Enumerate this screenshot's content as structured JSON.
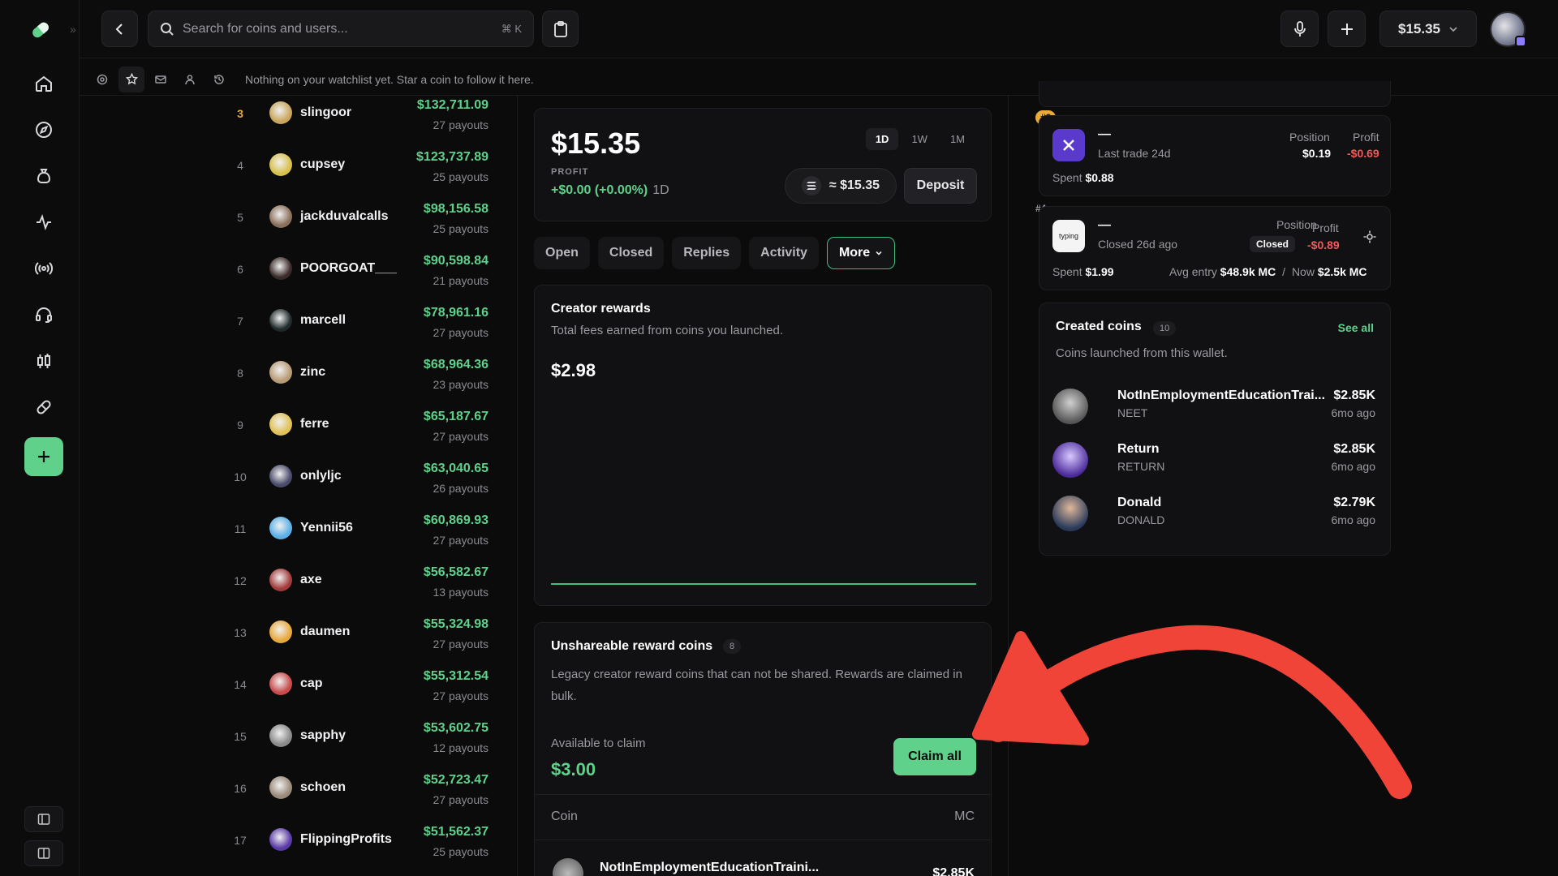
{
  "header": {
    "search_placeholder": "Search for coins and users...",
    "search_shortcut": "⌘  K",
    "balance": "$15.35"
  },
  "watchlist": {
    "message": "Nothing on your watchlist yet. Star a coin to follow it here."
  },
  "leaderboard": [
    {
      "rank": "3",
      "name": "slingoor",
      "amount": "$132,711.09",
      "payouts": "27 payouts",
      "color": "#c9a55a"
    },
    {
      "rank": "4",
      "name": "cupsey",
      "amount": "$123,737.89",
      "payouts": "25 payouts",
      "color": "#d8c04a"
    },
    {
      "rank": "5",
      "name": "jackduvalcalls",
      "amount": "$98,156.58",
      "payouts": "25 payouts",
      "color": "#8a6f5a"
    },
    {
      "rank": "6",
      "name": "POORGOAT___",
      "amount": "$90,598.84",
      "payouts": "21 payouts",
      "color": "#3a2a2a"
    },
    {
      "rank": "7",
      "name": "marcell",
      "amount": "$78,961.16",
      "payouts": "27 payouts",
      "color": "#1f2a2a"
    },
    {
      "rank": "8",
      "name": "zinc",
      "amount": "$68,964.36",
      "payouts": "23 payouts",
      "color": "#b89a74"
    },
    {
      "rank": "9",
      "name": "ferre",
      "amount": "$65,187.67",
      "payouts": "27 payouts",
      "color": "#e1c054"
    },
    {
      "rank": "10",
      "name": "onlyljc",
      "amount": "$63,040.65",
      "payouts": "26 payouts",
      "color": "#4a4a6a"
    },
    {
      "rank": "11",
      "name": "Yennii56",
      "amount": "$60,869.93",
      "payouts": "27 payouts",
      "color": "#5ab0e8"
    },
    {
      "rank": "12",
      "name": "axe",
      "amount": "$56,582.67",
      "payouts": "13 payouts",
      "color": "#a33a3a"
    },
    {
      "rank": "13",
      "name": "daumen",
      "amount": "$55,324.98",
      "payouts": "27 payouts",
      "color": "#e8a83a"
    },
    {
      "rank": "14",
      "name": "cap",
      "amount": "$55,312.54",
      "payouts": "27 payouts",
      "color": "#c84a4a"
    },
    {
      "rank": "15",
      "name": "sapphy",
      "amount": "$53,602.75",
      "payouts": "12 payouts",
      "color": "#8a8a8a"
    },
    {
      "rank": "16",
      "name": "schoen",
      "amount": "$52,723.47",
      "payouts": "27 payouts",
      "color": "#9a8a7a"
    },
    {
      "rank": "17",
      "name": "FlippingProfits",
      "amount": "$51,562.37",
      "payouts": "25 payouts",
      "color": "#5a3aa8"
    }
  ],
  "portfolio": {
    "balance": "$15.35",
    "profit_label": "PROFIT",
    "profit_value": "+$0.00 (+0.00%)",
    "profit_period": "1D",
    "ranges": [
      "1D",
      "1W",
      "1M"
    ],
    "sol_value": "≈ $15.35",
    "deposit_label": "Deposit"
  },
  "tabs": {
    "open": "Open",
    "closed": "Closed",
    "replies": "Replies",
    "activity": "Activity",
    "more": "More"
  },
  "creator_rewards": {
    "title": "Creator rewards",
    "subtitle": "Total fees earned from coins you launched.",
    "amount": "$2.98"
  },
  "unshareable": {
    "title": "Unshareable reward coins",
    "count": "8",
    "description": "Legacy creator reward coins that can not be shared. Rewards are claimed in bulk.",
    "available_label": "Available to claim",
    "available_amount": "$3.00",
    "claim_label": "Claim all",
    "col_coin": "Coin",
    "col_mc": "MC",
    "row_name": "NotInEmploymentEducationTraini...",
    "row_mc": "$2.85K"
  },
  "positions": [
    {
      "rank": "#3",
      "name": "—",
      "sub": "Last trade 24d",
      "position_label": "Position",
      "position_value": "$0.19",
      "profit_label": "Profit",
      "profit_value": "-$0.69",
      "spent_label": "Spent",
      "spent_value": "$0.88"
    },
    {
      "rank": "#4",
      "name": "—",
      "icon_text": "typing",
      "sub": "Closed 26d ago",
      "position_label": "Position",
      "position_value": "Closed",
      "profit_label": "Profit",
      "profit_value": "-$0.89",
      "spent_label": "Spent",
      "spent_value": "$1.99",
      "avg_entry_label": "Avg entry",
      "avg_entry_value": "$48.9k MC",
      "now_label": "Now",
      "now_value": "$2.5k MC",
      "separator": "/"
    }
  ],
  "created_coins": {
    "title": "Created coins",
    "count": "10",
    "see_all": "See all",
    "subtitle": "Coins launched from this wallet.",
    "items": [
      {
        "name": "NotInEmploymentEducationTrai...",
        "ticker": "NEET",
        "mc": "$2.85K",
        "age": "6mo ago"
      },
      {
        "name": "Return",
        "ticker": "RETURN",
        "mc": "$2.85K",
        "age": "6mo ago"
      },
      {
        "name": "Donald",
        "ticker": "DONALD",
        "mc": "$2.79K",
        "age": "6mo ago"
      }
    ]
  },
  "colors": {
    "accent": "#5fd18b",
    "negative": "#f05a5a",
    "annotation_arrow": "#f04438",
    "rank_gold": "#e9a93b"
  }
}
